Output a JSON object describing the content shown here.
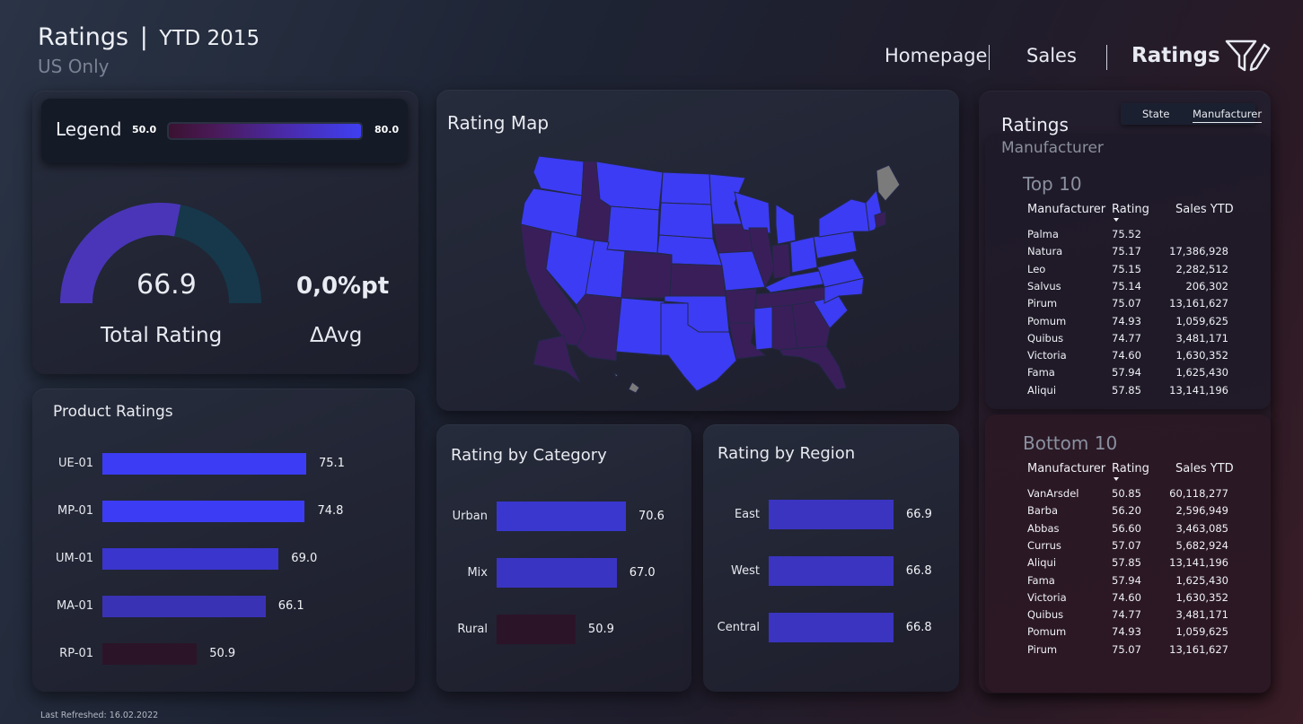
{
  "header": {
    "title": "Ratings",
    "title_sep": "|",
    "title_period": "YTD 2015",
    "subtitle": "US Only"
  },
  "nav": {
    "homepage": "Homepage",
    "sales": "Sales",
    "ratings": "Ratings"
  },
  "filter_icon": "filter-edit-icon",
  "legend": {
    "label": "Legend",
    "min": "50.0",
    "max": "80.0",
    "color_low": "#3b1230",
    "color_high": "#3f3ff2"
  },
  "gauge": {
    "value": "66.9",
    "value_num": 66.9,
    "min": 50,
    "max": 80,
    "label": "Total Rating",
    "delta_value": "0,0%pt",
    "delta_label": "ΔAvg"
  },
  "map": {
    "title": "Rating Map"
  },
  "product_ratings": {
    "title": "Product Ratings"
  },
  "category": {
    "title": "Rating by Category"
  },
  "region": {
    "title": "Rating by Region"
  },
  "chart_data": [
    {
      "type": "bar",
      "title": "Product Ratings",
      "categories": [
        "UE-01",
        "MP-01",
        "UM-01",
        "MA-01",
        "RP-01"
      ],
      "values": [
        75.1,
        74.8,
        69.0,
        66.1,
        50.9
      ],
      "labels": [
        "75.1",
        "74.8",
        "69.0",
        "66.1",
        "50.9"
      ],
      "colors": [
        "#3c3cf4",
        "#3c3cf4",
        "#3a35cc",
        "#3a32b4",
        "#2c1428"
      ]
    },
    {
      "type": "bar",
      "title": "Rating by Category",
      "categories": [
        "Urban",
        "Mix",
        "Rural"
      ],
      "values": [
        70.6,
        67.0,
        50.9
      ],
      "labels": [
        "70.6",
        "67.0",
        "50.9"
      ],
      "colors": [
        "#3a37cf",
        "#3a34c2",
        "#2c1428"
      ]
    },
    {
      "type": "bar",
      "title": "Rating by Region",
      "categories": [
        "East",
        "West",
        "Central"
      ],
      "values": [
        66.9,
        66.8,
        66.8
      ],
      "labels": [
        "66.9",
        "66.8",
        "66.8"
      ],
      "colors": [
        "#3a34c0",
        "#3a34c0",
        "#3a34c0"
      ]
    }
  ],
  "ratings_panel": {
    "title": "Ratings",
    "subtitle": "Manufacturer",
    "toggle_state": "State",
    "toggle_manufacturer": "Manufacturer",
    "columns": [
      "Manufacturer",
      "Rating",
      "Sales YTD"
    ],
    "top": {
      "title": "Top 10",
      "rows": [
        [
          "Palma",
          "75.52",
          ""
        ],
        [
          "Natura",
          "75.17",
          "17,386,928"
        ],
        [
          "Leo",
          "75.15",
          "2,282,512"
        ],
        [
          "Salvus",
          "75.14",
          "206,302"
        ],
        [
          "Pirum",
          "75.07",
          "13,161,627"
        ],
        [
          "Pomum",
          "74.93",
          "1,059,625"
        ],
        [
          "Quibus",
          "74.77",
          "3,481,171"
        ],
        [
          "Victoria",
          "74.60",
          "1,630,352"
        ],
        [
          "Fama",
          "57.94",
          "1,625,430"
        ],
        [
          "Aliqui",
          "57.85",
          "13,141,196"
        ]
      ]
    },
    "bottom": {
      "title": "Bottom 10",
      "rows": [
        [
          "VanArsdel",
          "50.85",
          "60,118,277"
        ],
        [
          "Barba",
          "56.20",
          "2,596,949"
        ],
        [
          "Abbas",
          "56.60",
          "3,463,085"
        ],
        [
          "Currus",
          "57.07",
          "5,682,924"
        ],
        [
          "Aliqui",
          "57.85",
          "13,141,196"
        ],
        [
          "Fama",
          "57.94",
          "1,625,430"
        ],
        [
          "Victoria",
          "74.60",
          "1,630,352"
        ],
        [
          "Quibus",
          "74.77",
          "3,481,171"
        ],
        [
          "Pomum",
          "74.93",
          "1,059,625"
        ],
        [
          "Pirum",
          "75.07",
          "13,161,627"
        ]
      ]
    }
  },
  "footer": "Last Refreshed: 16.02.2022"
}
